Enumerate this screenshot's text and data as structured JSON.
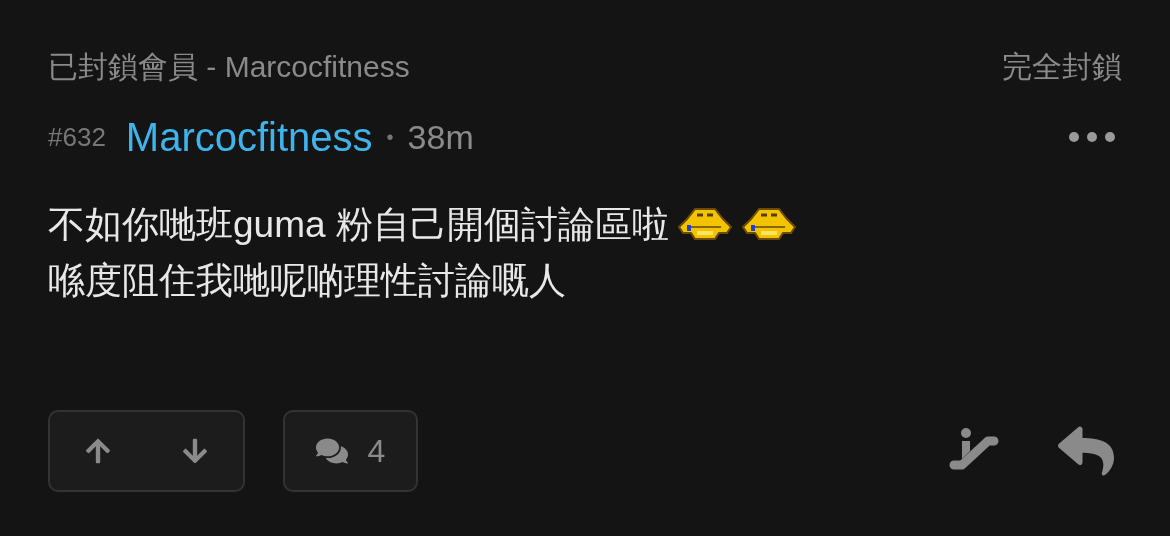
{
  "header": {
    "title": "已封鎖會員 - Marcocfitness",
    "action": "完全封鎖"
  },
  "post": {
    "number": "#632",
    "author": "Marcocfitness",
    "separator": "•",
    "time": "38m",
    "lines": [
      [
        {
          "kind": "text",
          "text": "不如你哋班guma 粉自己開個討論區啦"
        },
        {
          "kind": "emoji"
        },
        {
          "kind": "emoji"
        }
      ],
      [
        {
          "kind": "text",
          "text": "喺度阻住我哋呢啲理性討論嘅人"
        }
      ]
    ],
    "replies": "4"
  }
}
